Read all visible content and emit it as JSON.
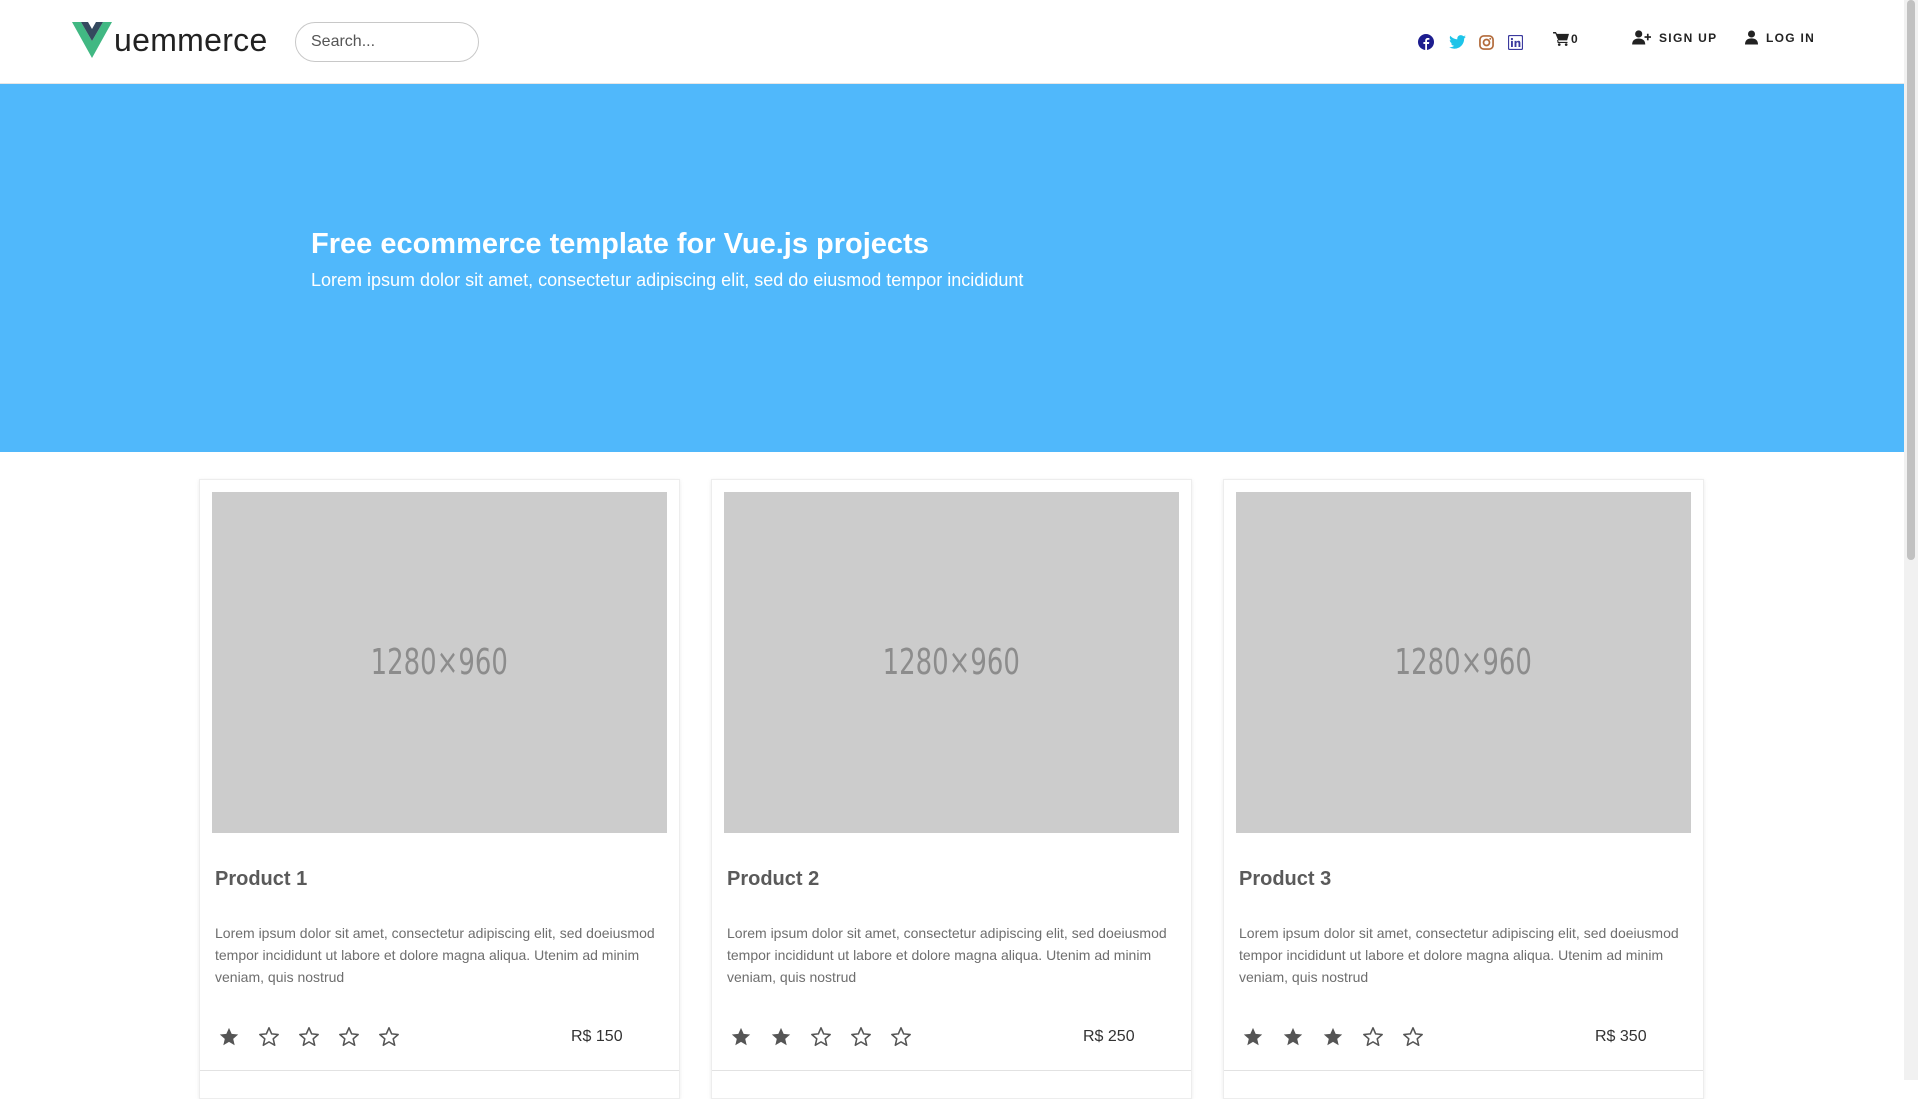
{
  "header": {
    "logo_text": "uemmerce",
    "logo_icon": "vue-logo-icon",
    "search": {
      "placeholder": "Search...",
      "value": ""
    },
    "social": [
      {
        "name": "facebook-icon",
        "color": "#1d1d8f"
      },
      {
        "name": "twitter-icon",
        "color": "#1dc4e9"
      },
      {
        "name": "instagram-icon",
        "color": "#b26a3a"
      },
      {
        "name": "linkedin-icon",
        "color": "#3b3a9e"
      }
    ],
    "cart": {
      "icon": "cart-icon",
      "count": "0"
    },
    "signup_label": "SIGN UP",
    "login_label": "LOG IN"
  },
  "hero": {
    "title": "Free ecommerce template for Vue.js projects",
    "subtitle": "Lorem ipsum dolor sit amet, consectetur adipiscing elit, sed do eiusmod tempor incididunt",
    "background": "#50b8fb"
  },
  "products": [
    {
      "image_label": "1280×960",
      "title": "Product 1",
      "description": "Lorem ipsum dolor sit amet, consectetur adipiscing elit, sed doeiusmod tempor incididunt ut labore et dolore magna aliqua. Utenim ad minim veniam, quis nostrud",
      "rating": 1,
      "rating_max": 5,
      "price": "R$ 150"
    },
    {
      "image_label": "1280×960",
      "title": "Product 2",
      "description": "Lorem ipsum dolor sit amet, consectetur adipiscing elit, sed doeiusmod tempor incididunt ut labore et dolore magna aliqua. Utenim ad minim veniam, quis nostrud",
      "rating": 2,
      "rating_max": 5,
      "price": "R$ 250"
    },
    {
      "image_label": "1280×960",
      "title": "Product 3",
      "description": "Lorem ipsum dolor sit amet, consectetur adipiscing elit, sed doeiusmod tempor incididunt ut labore et dolore magna aliqua. Utenim ad minim veniam, quis nostrud",
      "rating": 3,
      "rating_max": 5,
      "price": "R$ 350"
    }
  ]
}
